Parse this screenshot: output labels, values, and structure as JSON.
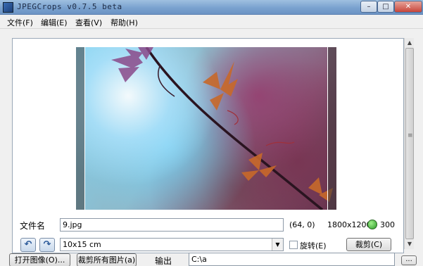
{
  "window": {
    "title": "JPEGCrops v0.7.5 beta",
    "min_glyph": "–",
    "max_glyph": "□",
    "close_glyph": "✕"
  },
  "menu": {
    "file": "文件(F)",
    "edit": "编辑(E)",
    "view": "查看(V)",
    "help": "帮助(H)"
  },
  "image": {
    "icons": [
      "photo-preview"
    ]
  },
  "scrollbar": {
    "up": "▲",
    "down": "▼",
    "grip": "≡"
  },
  "details": {
    "filename_label": "文件名",
    "filename_value": "9.jpg",
    "coords": "(64, 0)",
    "resolution": "1800x1200",
    "dpi": "300",
    "dpi_color": "#2c9a28"
  },
  "controls": {
    "rotate_left": "↶",
    "rotate_right": "↷",
    "size_value": "10x15 cm",
    "rotate_label": "旋转(E)",
    "crop_button": "裁剪(C)"
  },
  "bottom": {
    "open_button": "打开图像(O)...",
    "crop_all_button": "裁剪所有图片(a)",
    "output_label": "输出",
    "output_value": "C:\\a",
    "browse_button": "..."
  }
}
